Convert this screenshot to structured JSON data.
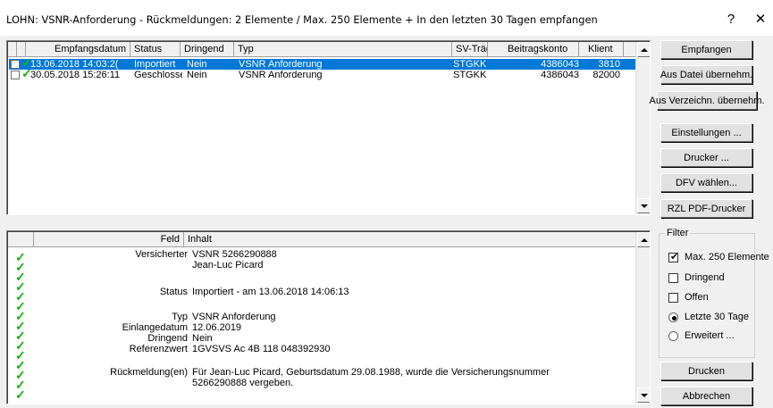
{
  "window": {
    "title": "LOHN: VSNR-Anforderung - Rückmeldungen: 2 Elemente / Max. 250 Elemente + In den letzten 30 Tagen empfangen",
    "help_glyph": "?",
    "close_glyph": "✕"
  },
  "list": {
    "columns": [
      "Empfangsdatum",
      "Status",
      "Dringend",
      "Typ",
      "SV-Träger",
      "Beitragskonto",
      "Klient"
    ],
    "rows": [
      {
        "empfangsdatum": "13.06.2018 14:03:2(",
        "status": "Importiert",
        "dringend": "Nein",
        "typ": "VSNR Anforderung",
        "sv_traeger": "STGKK",
        "beitragskonto": "4386043",
        "klient": "3810",
        "selected": true
      },
      {
        "empfangsdatum": "30.05.2018 15:26:11",
        "status": "Geschlosse",
        "dringend": "Nein",
        "typ": "VSNR Anforderung",
        "sv_traeger": "STGKK",
        "beitragskonto": "4386043",
        "klient": "82000",
        "selected": false
      }
    ]
  },
  "details": {
    "columns": [
      "Feld",
      "Inhalt"
    ],
    "lines": [
      {
        "key": "Versicherter",
        "value": "VSNR 5266290888"
      },
      {
        "key": "",
        "value": "Jean-Luc Picard"
      },
      {
        "key": "",
        "value": ""
      },
      {
        "key": "Status",
        "value": "Importiert - am 13.06.2018 14:06:13"
      },
      {
        "key": "",
        "value": ""
      },
      {
        "key": "Typ",
        "value": "VSNR Anforderung"
      },
      {
        "key": "Einlangedatum",
        "value": "12.06.2019"
      },
      {
        "key": "Dringend",
        "value": "Nein"
      },
      {
        "key": "Referenzwert",
        "value": "1GVSVS Ac  4B  118  048392930"
      },
      {
        "key": "",
        "value": ""
      },
      {
        "key": "Rückmeldung(en)",
        "value": "Für Jean-Luc Picard, Geburtsdatum 29.08.1988, wurde die Versicherungsnummer"
      },
      {
        "key": "",
        "value": "5266290888 vergeben."
      }
    ]
  },
  "buttons": {
    "empfangen": "Empfangen",
    "aus_datei": "Aus Datei übernehm.",
    "aus_verzeichn": "Aus Verzeichn. übernehm.",
    "einstellungen": "Einstellungen ...",
    "drucker": "Drucker ...",
    "dfv": "DFV wählen...",
    "rzl_pdf": "RZL PDF-Drucker",
    "drucken": "Drucken",
    "abbrechen": "Abbrechen"
  },
  "filter": {
    "title": "Filter",
    "max_elemente": {
      "label": "Max. 250 Elemente",
      "checked": true
    },
    "dringend": {
      "label": "Dringend",
      "checked": false
    },
    "offen": {
      "label": "Offen",
      "checked": false
    },
    "letzte_30": {
      "label": "Letzte 30 Tage",
      "selected": true
    },
    "erweitert": {
      "label": "Erweitert ...",
      "selected": false
    }
  },
  "check_glyph": "✓",
  "colors": {
    "selection": "#0078d7",
    "check": "#10b010"
  }
}
